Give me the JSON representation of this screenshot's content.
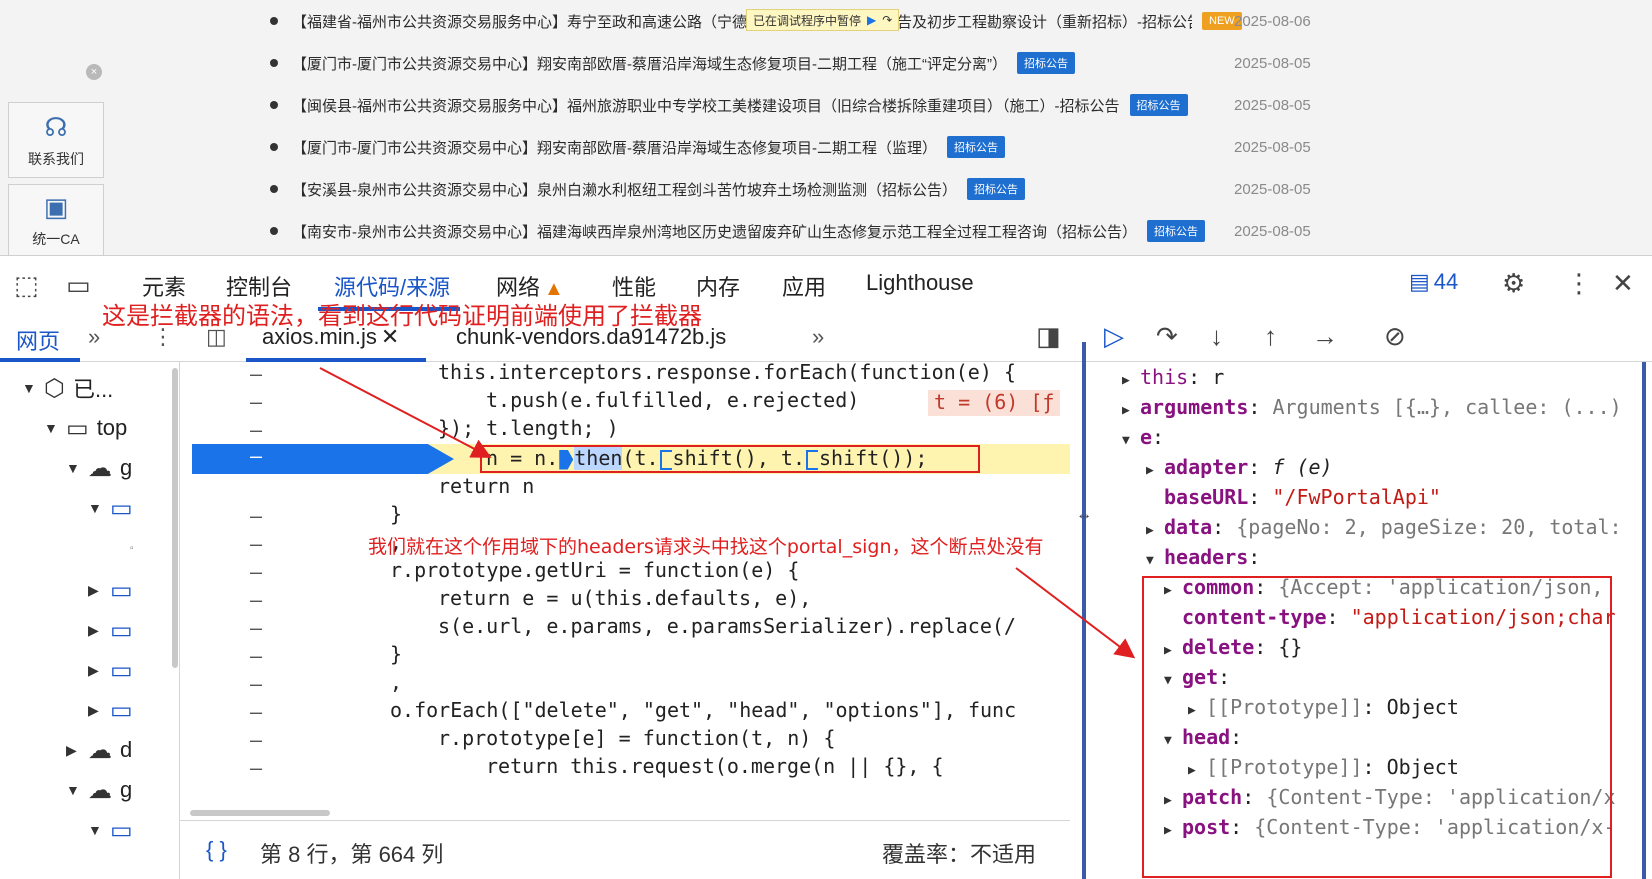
{
  "webpage": {
    "news": [
      {
        "title": "【福建省-福州市公共资源交易服务中心】寿宁至政和高速公路（宁德段）工程可行性研究报告及初步工程勘察设计（重新招标）-招标公告",
        "badge": "NEW",
        "date": "2025-08-06"
      },
      {
        "title": "【厦门市-厦门市公共资源交易中心】翔安南部欧厝-蔡厝沿岸海域生态修复项目-二期工程（施工“评定分离”）",
        "badge": "招标公告",
        "date": "2025-08-05"
      },
      {
        "title": "【闽侯县-福州市公共资源交易服务中心】福州旅游职业中专学校工美楼建设项目（旧综合楼拆除重建项目）（施工）-招标公告",
        "badge": "招标公告",
        "date": "2025-08-05"
      },
      {
        "title": "【厦门市-厦门市公共资源交易中心】翔安南部欧厝-蔡厝沿岸海域生态修复项目-二期工程（监理）",
        "badge": "招标公告",
        "date": "2025-08-05"
      },
      {
        "title": "【安溪县-泉州市公共资源交易中心】泉州白濑水利枢纽工程剑斗苦竹坡弃土场检测监测（招标公告）",
        "badge": "招标公告",
        "date": "2025-08-05"
      },
      {
        "title": "【南安市-泉州市公共资源交易中心】福建海峡西岸泉州湾地区历史遗留废弃矿山生态修复示范工程全过程工程咨询（招标公告）",
        "badge": "招标公告",
        "date": "2025-08-05"
      }
    ],
    "debug_paused": "已在调试程序中暂停",
    "contact_label": "联系我们",
    "ca_label": "统一CA"
  },
  "devtools": {
    "tabs": [
      "元素",
      "控制台",
      "源代码/来源",
      "网络",
      "性能",
      "内存",
      "应用",
      "Lighthouse"
    ],
    "issues_count": "44",
    "sub_tab": "网页",
    "file_tabs": [
      "axios.min.js",
      "chunk-vendors.da91472b.js"
    ],
    "tree": [
      "已...",
      "top",
      "g",
      "d",
      "g"
    ],
    "code_lines": [
      "this.interceptors.response.forEach(function(e) {",
      "t.push(e.fulfilled, e.rejected)",
      "}); t.length; )",
      "n = n.",
      "return n",
      "}",
      ",",
      "r.prototype.getUri = function(e) {",
      "return e = u(this.defaults, e),",
      "s(e.url, e.params, e.paramsSerializer).replace(/",
      "}",
      ",",
      "o.forEach([\"delete\", \"get\", \"head\", \"options\"], func",
      "r.prototype[e] = function(t, n) {",
      "return this.request(o.merge(n || {}, {"
    ],
    "inline_value": "t = (6) [ƒ",
    "status_position": "第 8 行，第 664 列",
    "status_coverage": "覆盖率：不适用",
    "scope": {
      "this_val": "r",
      "arguments_val": "Arguments [{…}, callee: (...)",
      "adapter_val": "f (e)",
      "baseURL_val": "\"/FwPortalApi\"",
      "data_val": "{pageNo: 2, pageSize: 20, total:",
      "common_val": "{Accept: 'application/json, ",
      "content_type_val": "\"application/json;char",
      "delete_val": "{}",
      "prototype_val": "Object",
      "patch_val": "{Content-Type: 'application/x",
      "post_val": "{Content-Type: 'application/x-"
    }
  },
  "annotations": {
    "top": "这是拦截器的语法，看到这行代码证明前端使用了拦截器",
    "middle": "我们就在这个作用域下的headers请求头中找这个portal_sign，这个断点处没有"
  },
  "colors": {
    "accent": "#1a56c8",
    "annotation": "#e02020",
    "highlight": "#fff3b0"
  }
}
